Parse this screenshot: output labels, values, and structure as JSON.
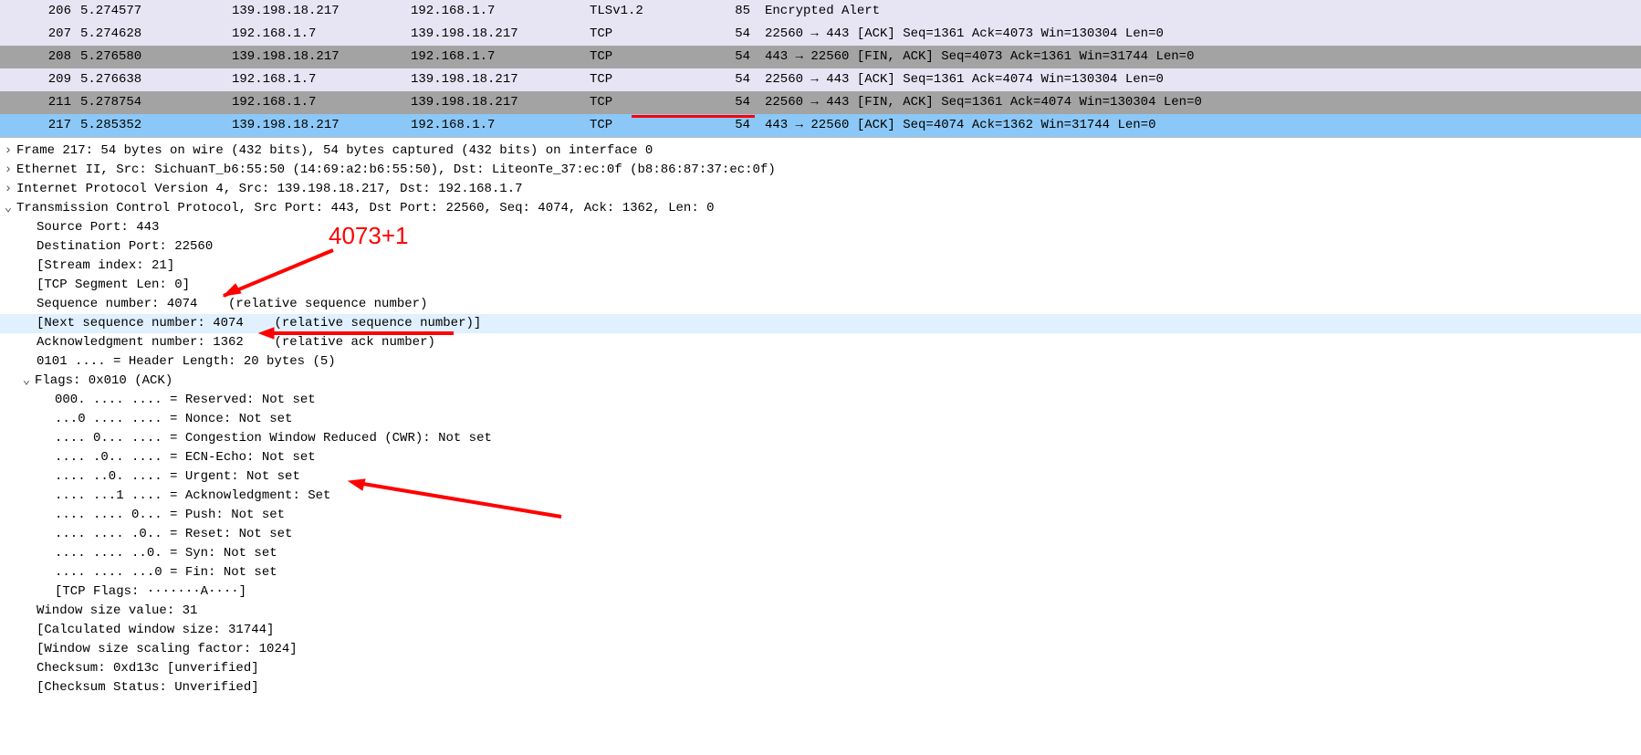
{
  "annotation_text": "4073+1",
  "packets": [
    {
      "no": "206",
      "time": "5.274577",
      "src": "139.198.18.217",
      "dst": "192.168.1.7",
      "proto": "TLSv1.2",
      "len": "85",
      "info": "Encrypted Alert",
      "cls": "purple"
    },
    {
      "no": "207",
      "time": "5.274628",
      "src": "192.168.1.7",
      "dst": "139.198.18.217",
      "proto": "TCP",
      "len": "54",
      "info": "22560 → 443 [ACK] Seq=1361 Ack=4073 Win=130304 Len=0",
      "cls": "purple"
    },
    {
      "no": "208",
      "time": "5.276580",
      "src": "139.198.18.217",
      "dst": "192.168.1.7",
      "proto": "TCP",
      "len": "54",
      "info": "443 → 22560 [FIN, ACK] Seq=4073 Ack=1361 Win=31744 Len=0",
      "cls": "gray"
    },
    {
      "no": "209",
      "time": "5.276638",
      "src": "192.168.1.7",
      "dst": "139.198.18.217",
      "proto": "TCP",
      "len": "54",
      "info": "22560 → 443 [ACK] Seq=1361 Ack=4074 Win=130304 Len=0",
      "cls": "purple"
    },
    {
      "no": "211",
      "time": "5.278754",
      "src": "192.168.1.7",
      "dst": "139.198.18.217",
      "proto": "TCP",
      "len": "54",
      "info": "22560 → 443 [FIN, ACK] Seq=1361 Ack=4074 Win=130304 Len=0",
      "cls": "gray"
    },
    {
      "no": "217",
      "time": "5.285352",
      "src": "139.198.18.217",
      "dst": "192.168.1.7",
      "proto": "TCP",
      "len": "54",
      "info": "443 → 22560 [ACK] Seq=4074 Ack=1362 Win=31744 Len=0",
      "cls": "selected"
    }
  ],
  "details": {
    "frame": "Frame 217: 54 bytes on wire (432 bits), 54 bytes captured (432 bits) on interface 0",
    "eth": "Ethernet II, Src: SichuanT_b6:55:50 (14:69:a2:b6:55:50), Dst: LiteonTe_37:ec:0f (b8:86:87:37:ec:0f)",
    "ip": "Internet Protocol Version 4, Src: 139.198.18.217, Dst: 192.168.1.7",
    "tcp_header": "Transmission Control Protocol, Src Port: 443, Dst Port: 22560, Seq: 4074, Ack: 1362, Len: 0",
    "src_port": "Source Port: 443",
    "dst_port": "Destination Port: 22560",
    "stream": "[Stream index: 21]",
    "seglen": "[TCP Segment Len: 0]",
    "seq": "Sequence number: 4074    (relative sequence number)",
    "nxt": "[Next sequence number: 4074    (relative sequence number)]",
    "ack": "Acknowledgment number: 1362    (relative ack number)",
    "hlen": "0101 .... = Header Length: 20 bytes (5)",
    "flags_header": "Flags: 0x010 (ACK)",
    "flags": {
      "res": "000. .... .... = Reserved: Not set",
      "nonce": "...0 .... .... = Nonce: Not set",
      "cwr": ".... 0... .... = Congestion Window Reduced (CWR): Not set",
      "ecn": ".... .0.. .... = ECN-Echo: Not set",
      "urg": ".... ..0. .... = Urgent: Not set",
      "ackf": ".... ...1 .... = Acknowledgment: Set",
      "psh": ".... .... 0... = Push: Not set",
      "rst": ".... .... .0.. = Reset: Not set",
      "syn": ".... .... ..0. = Syn: Not set",
      "fin": ".... .... ...0 = Fin: Not set",
      "summary": "[TCP Flags: ·······A····]"
    },
    "win": "Window size value: 31",
    "calcwin": "[Calculated window size: 31744]",
    "scale": "[Window size scaling factor: 1024]",
    "cksum": "Checksum: 0xd13c [unverified]",
    "cksum_status": "[Checksum Status: Unverified]"
  }
}
